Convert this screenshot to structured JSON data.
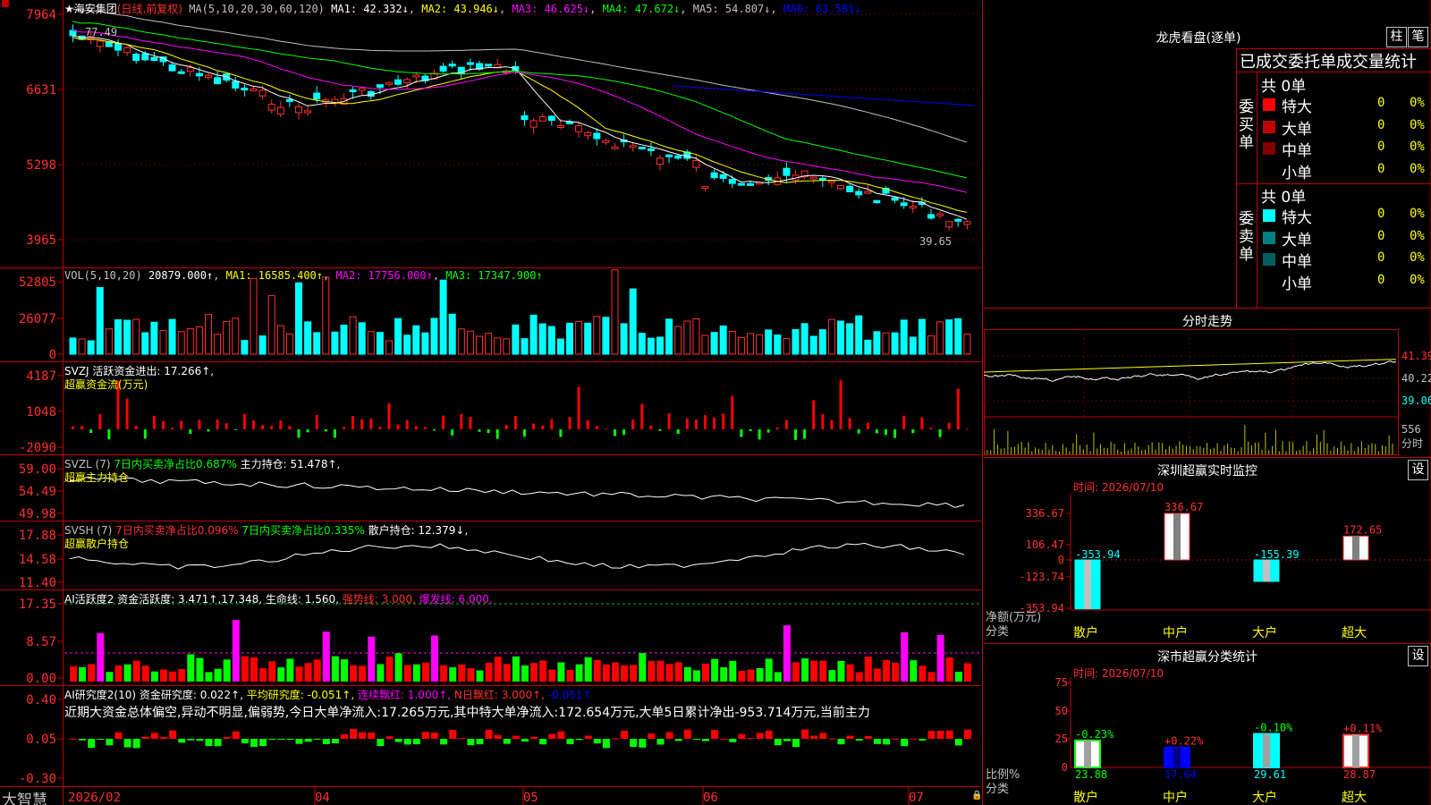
{
  "stock": {
    "name": "★海安集团",
    "mode": "(日线,前复权)"
  },
  "ma": {
    "prefix": "MA(5,10,20,30,60,120)",
    "items": [
      "MA1: 42.332↓",
      "MA2: 43.946↓",
      "MA3: 46.625↓",
      "MA4: 47.672↓",
      "MA5: 54.807↓",
      "MA6: 63.581↓"
    ],
    "colors": [
      "#ffffff",
      "#ffff00",
      "#ff00ff",
      "#00ff00",
      "#c0c0c0",
      "#0000ff"
    ]
  },
  "price_axis": [
    "7964",
    "6631",
    "5298",
    "3965"
  ],
  "price_labels": {
    "high": "77.49",
    "low": "39.65"
  },
  "vol": {
    "header": "VOL(5,10,20)",
    "value": "20879.000↑",
    "ma1": "MA1: 16585.400↑",
    "ma2": "MA2: 17756.000↑",
    "ma3": "MA3: 17347.900↑",
    "axis": [
      "52805",
      "26077",
      "0"
    ]
  },
  "svzj": {
    "header": "SVZJ  活跃资金进出: 17.266↑,",
    "sub": "超赢资金流(万元)",
    "axis": [
      "4187",
      "1048",
      "-2090"
    ]
  },
  "svzl": {
    "header1": "SVZL (7)",
    "header2": "7日内买卖净占比0.687%",
    "header3": "主力持仓: 51.478↑,",
    "sub": "超赢主力持仓",
    "axis": [
      "59.00",
      "54.49",
      "49.98"
    ]
  },
  "svsh": {
    "header1": "SVSH (7)",
    "header2": "7日内买卖净占比0.096%",
    "header3": "7日内买卖净占比0.335%",
    "header4": "散户持仓: 12.379↓,",
    "sub": "超赢散户持仓",
    "axis": [
      "17.88",
      "14.58",
      "11.40"
    ]
  },
  "ai": {
    "header": "AI活跃度2 资金活跃度: 3.471↑,17.348,",
    "life": "生命线: 1.560,",
    "strong": "强势线: 3.000,",
    "burst": "爆发线: 6.000,",
    "axis": [
      "17.35",
      "8.57",
      "0.00"
    ]
  },
  "research": {
    "header": "AI研究度2(10) 资金研究度: 0.022↑,",
    "avg": "平均研究度: -0.051↑,",
    "red": "连续飘红: 1.000↑,",
    "n": "N日飘红: 3.000↑,",
    "last": "-0.051↑",
    "comment": "近期大资金总体偏空,异动不明显,偏弱势,今日大单净流入:17.265万元,其中特大单净流入:172.654万元,大单5日累计净出-953.714万元,当前主力",
    "axis": [
      "0.40",
      "0.05",
      "-0.30"
    ]
  },
  "date_axis": [
    "2026/02",
    "04",
    "05",
    "06",
    "07"
  ],
  "brand": "大智慧",
  "right": {
    "lhb_title": "龙虎看盘(逐单)",
    "btn_zhu": "柱",
    "btn_bi": "笔",
    "order_header": "已成交委托单成交量统计",
    "buy_label": "委买单",
    "sell_label": "委卖单",
    "buy_total": "共 0单",
    "sell_total": "共 0单",
    "buy_rows": [
      {
        "name": "特大",
        "v": "0",
        "p": "0%"
      },
      {
        "name": "大单",
        "v": "0",
        "p": "0%"
      },
      {
        "name": "中单",
        "v": "0",
        "p": "0%"
      },
      {
        "name": "小单",
        "v": "0",
        "p": "0%"
      }
    ],
    "sell_rows": [
      {
        "name": "特大",
        "v": "0",
        "p": "0%"
      },
      {
        "name": "大单",
        "v": "0",
        "p": "0%"
      },
      {
        "name": "中单",
        "v": "0",
        "p": "0%"
      },
      {
        "name": "小单",
        "v": "0",
        "p": "0%"
      }
    ],
    "intraday_title": "分时走势",
    "intraday_axis": [
      "41.39",
      "40.22",
      "39.06"
    ],
    "intraday_vol": "556",
    "intraday_vol_label": "分时",
    "sz_title": "深圳超赢实时监控",
    "sz_time": "时间: 2026/07/10",
    "sz_axis": [
      "336.67",
      "106.47",
      "0",
      "-123.74",
      "-353.94"
    ],
    "sz_bars": [
      {
        "label": "-353.94",
        "value": -353.94
      },
      {
        "label": "336.67",
        "value": 336.67
      },
      {
        "label": "-155.39",
        "value": -155.39
      },
      {
        "label": "172.65",
        "value": 172.65
      }
    ],
    "sz_yname": "净额(万元)",
    "sz_xname": "分类",
    "categories": [
      "散户",
      "中户",
      "大户",
      "超大"
    ],
    "cls_title": "深市超赢分类统计",
    "cls_time": "时间: 2026/07/10",
    "cls_axis": [
      "75",
      "50",
      "25",
      "0"
    ],
    "cls_bars": [
      {
        "top": "-0.23%",
        "bottom": "23.88",
        "value": 23.88
      },
      {
        "top": "+0.22%",
        "bottom": "17.64",
        "value": 17.64
      },
      {
        "top": "-0.10%",
        "bottom": "29.61",
        "value": 29.61
      },
      {
        "top": "+0.11%",
        "bottom": "28.87",
        "value": 28.87
      }
    ],
    "cls_yname": "比例%",
    "cls_xname": "分类",
    "set": "设"
  }
}
